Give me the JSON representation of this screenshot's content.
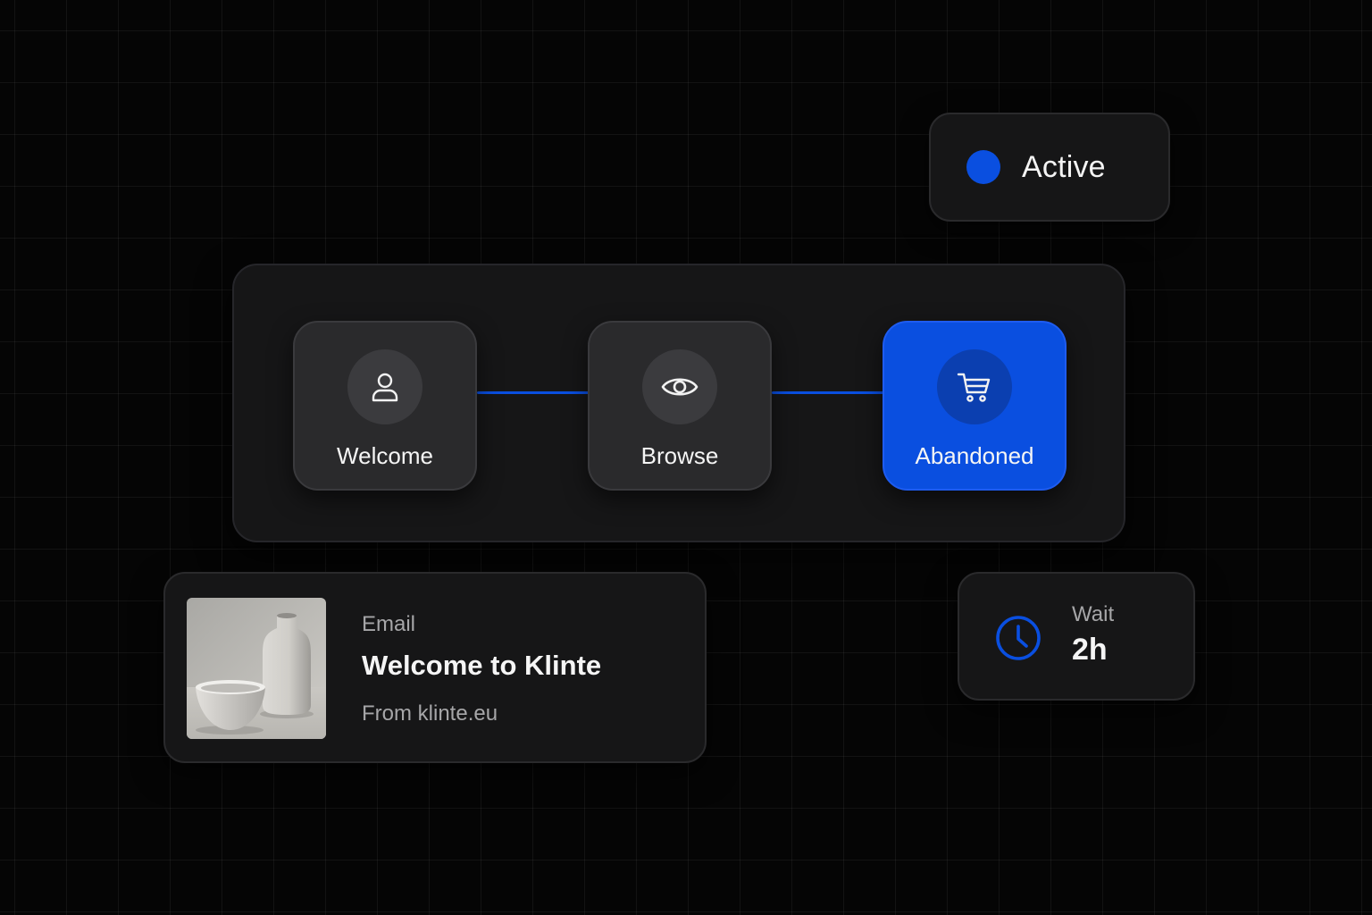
{
  "colors": {
    "accent": "#0a4fe0",
    "background": "#050505",
    "card": "#161617",
    "node": "#2a2a2c"
  },
  "status": {
    "label": "Active",
    "dot_color": "#0a4fe0"
  },
  "flow": {
    "steps": [
      {
        "label": "Welcome",
        "icon": "user-icon",
        "active": false
      },
      {
        "label": "Browse",
        "icon": "eye-icon",
        "active": false
      },
      {
        "label": "Abandoned",
        "icon": "shopping-cart-icon",
        "active": true
      }
    ]
  },
  "email": {
    "type_label": "Email",
    "subject": "Welcome to Klinte",
    "from": "From klinte.eu",
    "thumbnail": "vase-and-bowl-photo"
  },
  "wait": {
    "label": "Wait",
    "value": "2h",
    "icon": "clock-icon"
  }
}
